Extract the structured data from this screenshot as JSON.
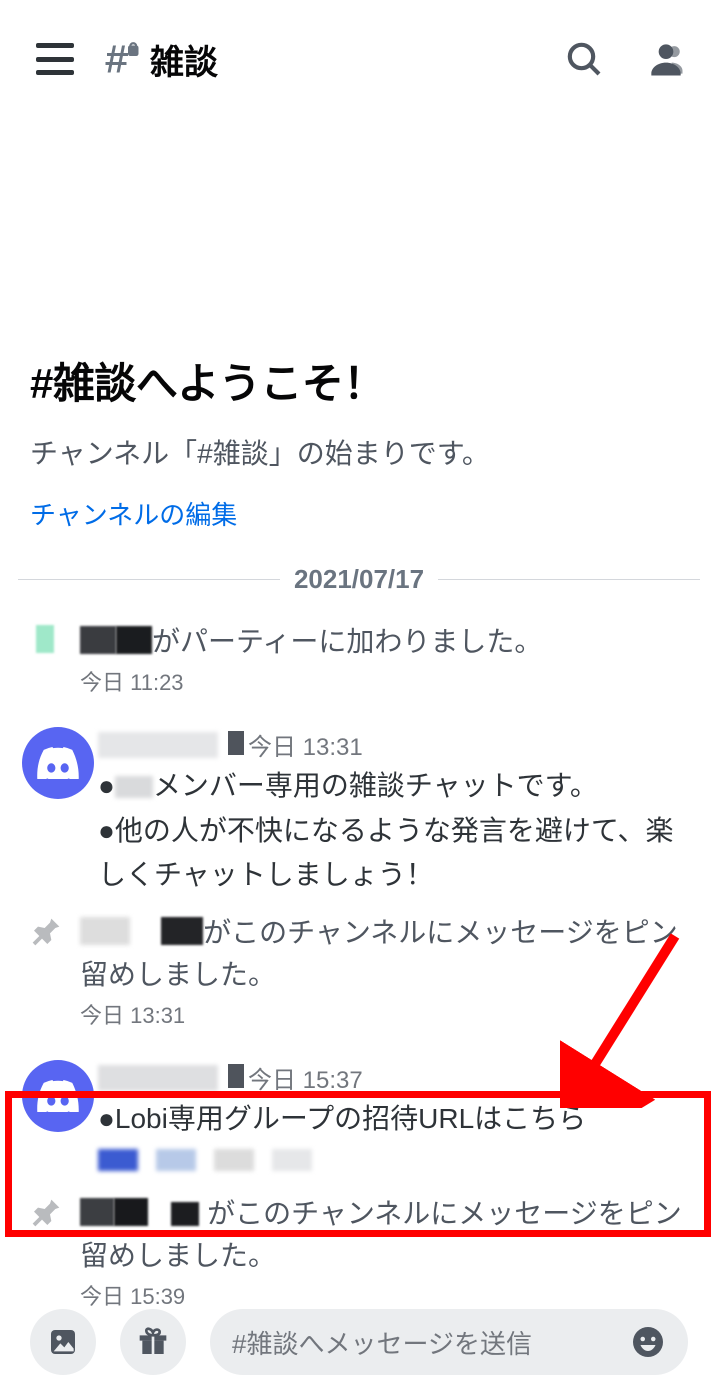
{
  "header": {
    "channel_name": "雑談"
  },
  "welcome": {
    "title": "#雑談へようこそ！",
    "subtitle": "チャンネル「#雑談」の始まりです。",
    "edit_link": "チャンネルの編集"
  },
  "divider_date": "2021/07/17",
  "messages": {
    "join": {
      "text_suffix": "がパーティーに加わりました。",
      "timestamp": "今日 11:23"
    },
    "rules": {
      "timestamp_prefix": "今日 13:31",
      "line1_prefix": "●",
      "line1_rest": "メンバー専用の雑談チャットです。",
      "line2": "●他の人が不快になるような発言を避けて、楽しくチャットしましょう！"
    },
    "pin1": {
      "text_suffix": "がこのチャンネルにメッセージをピン留めしました。",
      "timestamp": "今日 13:31"
    },
    "invite": {
      "timestamp_prefix": "今日 15:37",
      "text": "●Lobi専用グループの招待URLはこちら"
    },
    "pin2": {
      "text_suffix": "がこのチャンネルにメッセージをピン留めしました。",
      "timestamp": "今日 15:39"
    }
  },
  "input": {
    "placeholder": "#雑談へメッセージを送信"
  }
}
